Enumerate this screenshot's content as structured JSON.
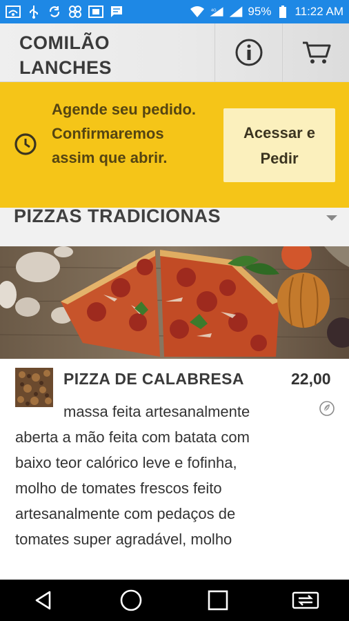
{
  "status_bar": {
    "battery": "95%",
    "time": "11:22 AM",
    "network": "4G",
    "icons": [
      "wifi-icon",
      "usb-icon",
      "sync-icon",
      "vpn-icon",
      "cast-icon",
      "message-icon"
    ]
  },
  "header": {
    "title": "COMILÃO LANCHES",
    "info_icon": "info-icon",
    "cart_icon": "cart-icon"
  },
  "banner": {
    "message": "Agende seu pedido. Confirmaremos assim que abrir.",
    "button_label": "Acessar e Pedir",
    "icon": "clock-icon",
    "color": "#f5c518"
  },
  "section": {
    "title": "PIZZAS TRADICIONAS"
  },
  "product": {
    "name": "PIZZA DE CALABRESA",
    "price": "22,00",
    "description": "massa feita artesanalmente aberta a mão feita com batata com baixo teor calórico leve e fofinha, molho de tomates frescos feito artesanalmente com pedaços de tomates super agradável, molho"
  },
  "nav": {
    "back": "back-icon",
    "home": "home-icon",
    "recents": "recents-icon",
    "switch": "switch-icon"
  }
}
